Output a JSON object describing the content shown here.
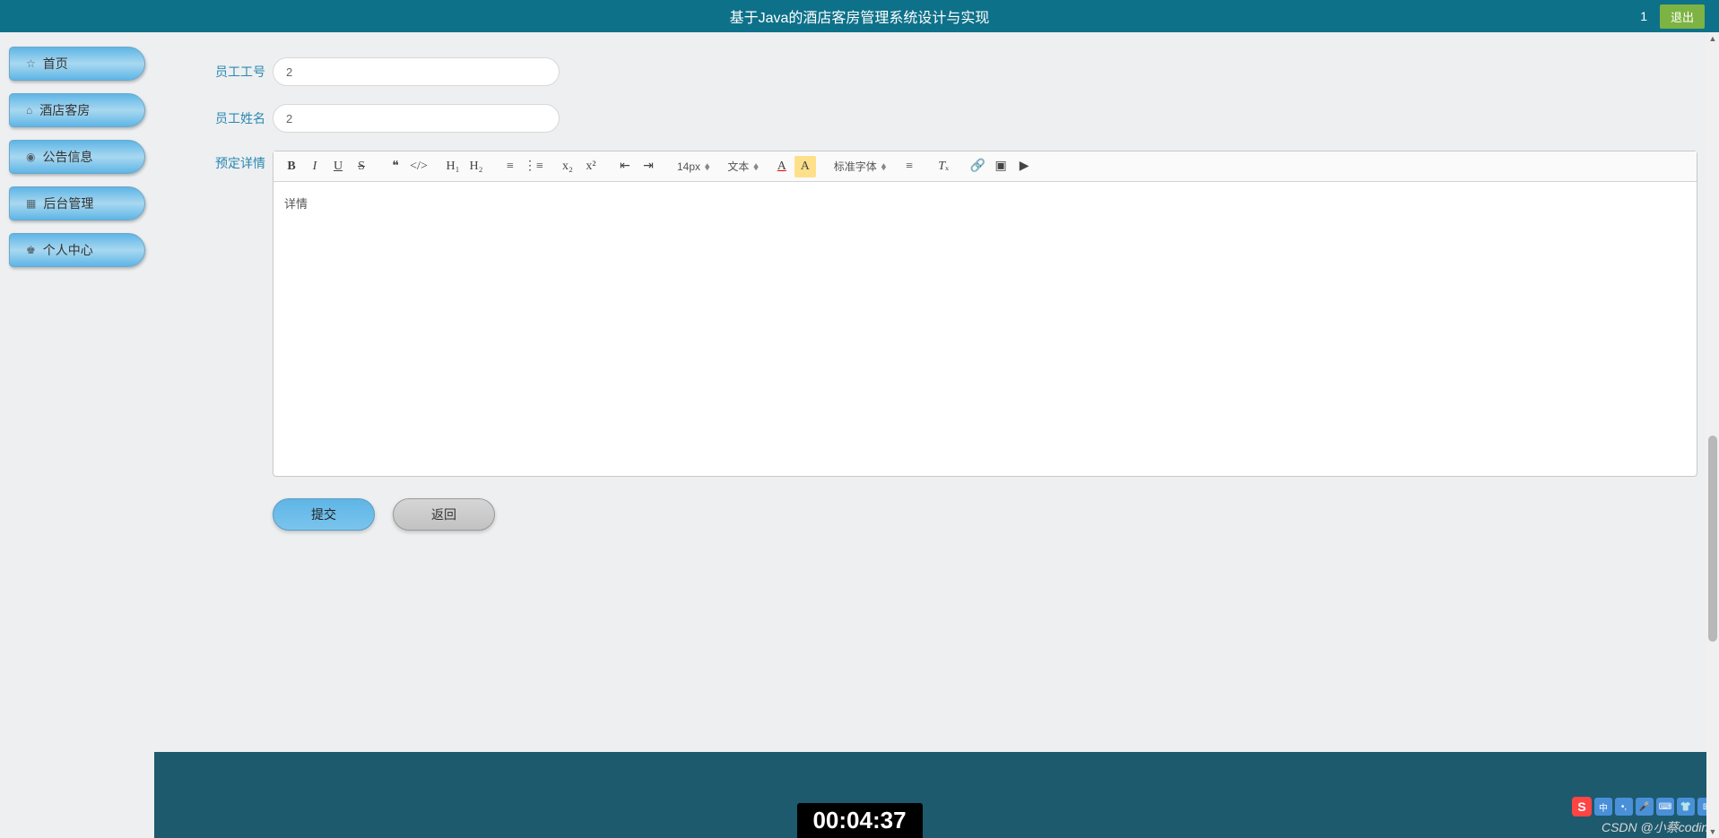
{
  "header": {
    "title": "基于Java的酒店客房管理系统设计与实现",
    "user": "1",
    "logout_label": "退出"
  },
  "sidebar": {
    "items": [
      {
        "icon": "☆",
        "label": "首页"
      },
      {
        "icon": "⌂",
        "label": "酒店客房"
      },
      {
        "icon": "◉",
        "label": "公告信息"
      },
      {
        "icon": "▦",
        "label": "后台管理"
      },
      {
        "icon": "♚",
        "label": "个人中心"
      }
    ]
  },
  "form": {
    "emp_id_label": "员工工号",
    "emp_id_value": "2",
    "emp_name_label": "员工姓名",
    "emp_name_value": "2",
    "details_label": "预定详情",
    "editor_content": "详情"
  },
  "toolbar": {
    "font_size": "14px",
    "text_style": "文本",
    "font_family": "标准字体"
  },
  "buttons": {
    "submit_label": "提交",
    "back_label": "返回"
  },
  "overlay": {
    "timer": "00:04:37",
    "watermark": "CSDN @小蔡coding"
  }
}
